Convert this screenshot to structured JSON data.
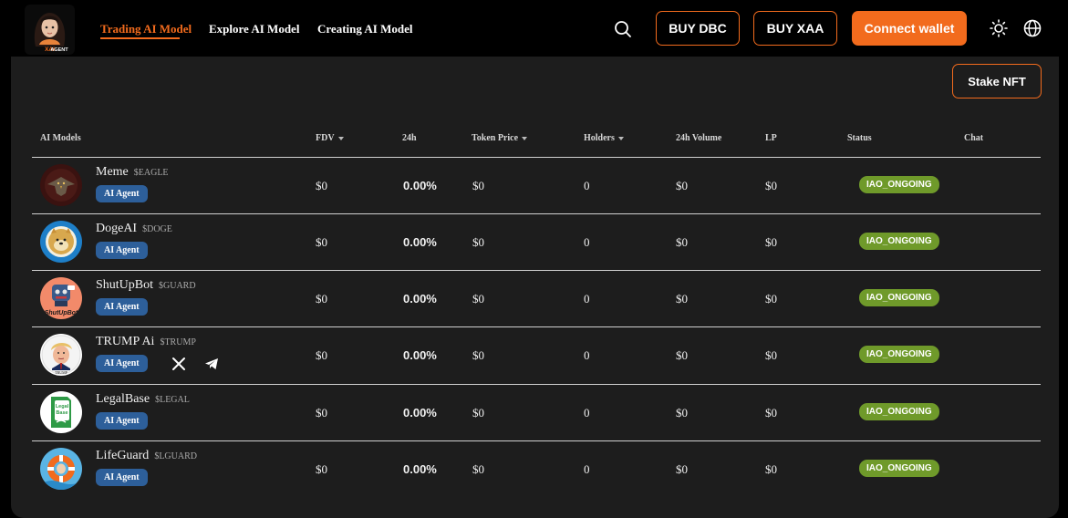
{
  "header": {
    "logo_text": "XAIAGENT",
    "nav": [
      {
        "label": "Trading AI Model",
        "active": true
      },
      {
        "label": "Explore AI Model",
        "active": false
      },
      {
        "label": "Creating AI Model",
        "active": false
      }
    ],
    "buy_dbc": "BUY DBC",
    "buy_xaa": "BUY XAA",
    "connect_wallet": "Connect wallet",
    "icons": [
      "search-icon",
      "sun-icon",
      "globe-icon"
    ],
    "accent_color": "#f26b1d"
  },
  "main": {
    "stake_button": "Stake NFT",
    "columns": [
      "AI Models",
      "FDV",
      "24h",
      "Token Price",
      "Holders",
      "24h Volume",
      "LP",
      "Status",
      "Chat"
    ],
    "sortable_columns": [
      "FDV",
      "Token Price",
      "Holders"
    ],
    "rows": [
      {
        "name": "Meme",
        "ticker": "$EAGLE",
        "tag": "AI Agent",
        "fdv": "$0",
        "change_24h": "0.00%",
        "token_price": "$0",
        "holders": "0",
        "volume_24h": "$0",
        "lp": "$0",
        "status": "IAO_ONGOING",
        "socials": []
      },
      {
        "name": "DogeAI",
        "ticker": "$DOGE",
        "tag": "AI Agent",
        "fdv": "$0",
        "change_24h": "0.00%",
        "token_price": "$0",
        "holders": "0",
        "volume_24h": "$0",
        "lp": "$0",
        "status": "IAO_ONGOING",
        "socials": []
      },
      {
        "name": "ShutUpBot",
        "ticker": "$GUARD",
        "tag": "AI Agent",
        "fdv": "$0",
        "change_24h": "0.00%",
        "token_price": "$0",
        "holders": "0",
        "volume_24h": "$0",
        "lp": "$0",
        "status": "IAO_ONGOING",
        "socials": [],
        "avatar_text": "ShutUpBot"
      },
      {
        "name": "TRUMP Ai",
        "ticker": "$TRUMP",
        "tag": "AI Agent",
        "fdv": "$0",
        "change_24h": "0.00%",
        "token_price": "$0",
        "holders": "0",
        "volume_24h": "$0",
        "lp": "$0",
        "status": "IAO_ONGOING",
        "socials": [
          "x-icon",
          "telegram-icon"
        ],
        "avatar_text": "TRUMP"
      },
      {
        "name": "LegalBase",
        "ticker": "$LEGAL",
        "tag": "AI Agent",
        "fdv": "$0",
        "change_24h": "0.00%",
        "token_price": "$0",
        "holders": "0",
        "volume_24h": "$0",
        "lp": "$0",
        "status": "IAO_ONGOING",
        "socials": [],
        "avatar_text": "Legal Base"
      },
      {
        "name": "LifeGuard",
        "ticker": "$LGUARD",
        "tag": "AI Agent",
        "fdv": "$0",
        "change_24h": "0.00%",
        "token_price": "$0",
        "holders": "0",
        "volume_24h": "$0",
        "lp": "$0",
        "status": "IAO_ONGOING",
        "socials": []
      }
    ],
    "status_color": "#6f9a2a",
    "tag_color": "#2d5f9a"
  }
}
